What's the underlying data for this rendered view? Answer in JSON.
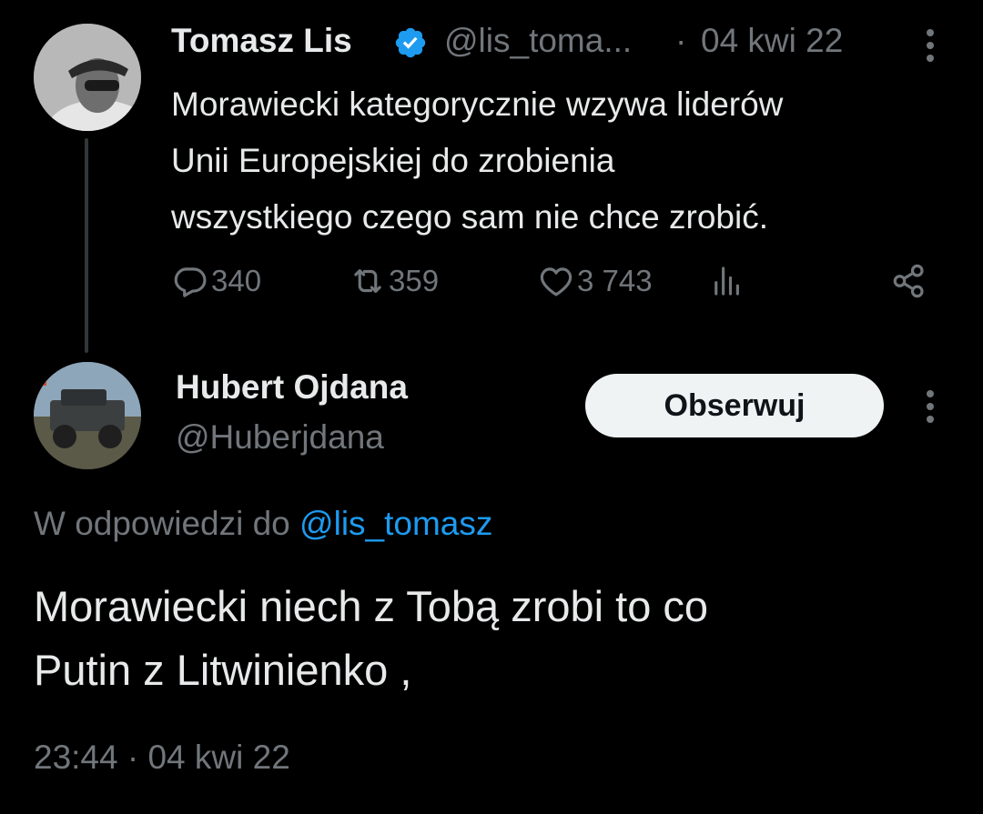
{
  "parent_tweet": {
    "author_name": "Tomasz Lis",
    "handle": "@lis_toma...",
    "separator": "·",
    "date": "04 kwi 22",
    "text_lines": [
      "Morawiecki kategorycznie wzywa liderów",
      "Unii Europejskiej do zrobienia",
      "wszystkiego czego sam nie chce zrobić."
    ],
    "actions": {
      "replies": "340",
      "retweets": "359",
      "likes": "3 743"
    }
  },
  "reply_tweet": {
    "author_name": "Hubert Ojdana",
    "handle": "@Huberjdana",
    "follow_label": "Obserwuj",
    "replying_prefix": "W odpowiedzi do",
    "replying_to": "@lis_tomasz",
    "text_lines": [
      "Morawiecki niech z Tobą zrobi to co",
      "Putin z Litwinienko ,"
    ],
    "timestamp": "23:44 · 04 kwi 22"
  },
  "icons": {
    "verified": "verified-badge-icon",
    "more": "more-options-icon",
    "reply": "reply-icon",
    "retweet": "retweet-icon",
    "like": "like-icon",
    "views": "views-icon",
    "share": "share-icon"
  },
  "colors": {
    "background": "#000000",
    "text": "#e7e9ea",
    "muted": "#71767b",
    "link": "#1d9bf0",
    "verified": "#1d9bf0",
    "follow_button_bg": "#eff3f4"
  }
}
